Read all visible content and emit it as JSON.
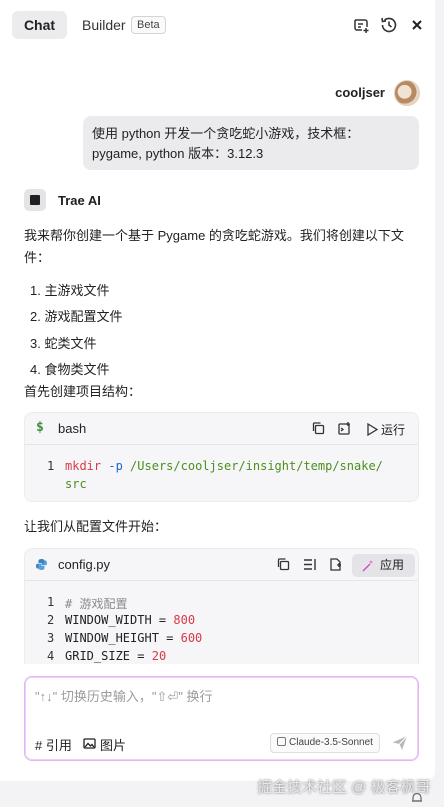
{
  "header": {
    "tab_chat": "Chat",
    "tab_builder": "Builder",
    "beta_badge": "Beta",
    "icons": [
      "new-chat-icon",
      "history-icon",
      "close-icon"
    ]
  },
  "user": {
    "name": "cooljser",
    "message_line1": "使用 python 开发一个贪吃蛇小游戏，技术框：",
    "message_line2": "pygame, python 版本：3.12.3"
  },
  "assistant": {
    "name": "Trae AI",
    "intro_line1": "我来帮你创建一个基于 Pygame 的贪吃蛇游戏。我们将创建以下文",
    "intro_line2": "件：",
    "files": [
      "1. 主游戏文件",
      "2. 游戏配置文件",
      "3. 蛇类文件",
      "4. 食物类文件"
    ],
    "step1": "首先创建项目结构：",
    "step2": "让我们从配置文件开始："
  },
  "code_bash": {
    "lang": "bash",
    "run_label": "运行",
    "line_no": "1",
    "cmd": "mkdir",
    "flag": "-p",
    "path_part1": "/Users/cooljser/insight/temp/snake/",
    "path_part2": "src"
  },
  "code_config": {
    "filename": "config.py",
    "apply_label": "应用",
    "lines": [
      {
        "no": "1",
        "text": "# 游戏配置"
      },
      {
        "no": "2",
        "name": "WINDOW_WIDTH",
        "op": " = ",
        "value": "800"
      },
      {
        "no": "3",
        "name": "WINDOW_HEIGHT",
        "op": " = ",
        "value": "600"
      },
      {
        "no": "4",
        "name": "GRID_SIZE",
        "op": " = ",
        "value": "20"
      }
    ]
  },
  "input": {
    "placeholder": "\"↑↓\" 切换历史输入，\"⇧⏎\" 换行",
    "ref_label": "# 引用",
    "image_label": "图片",
    "model": "Claude-3.5-Sonnet"
  },
  "watermark": "掘金技术社区 @ 极客枫哥",
  "colors": {
    "accent_border": "#d9b8ff",
    "code_keyword": "#d73a49",
    "code_flag": "#1a64c8",
    "code_path": "#4b8f1e"
  }
}
